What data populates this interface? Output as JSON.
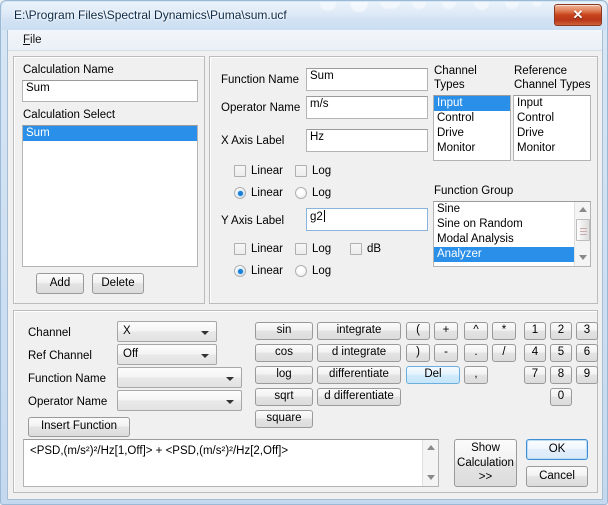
{
  "window": {
    "title": "E:\\Program Files\\Spectral Dynamics\\Puma\\sum.ucf",
    "close_label": "✕"
  },
  "menubar": {
    "file_label": "File"
  },
  "left_panel": {
    "calculation_name_label": "Calculation Name",
    "calculation_name_value": "Sum",
    "calculation_select_label": "Calculation Select",
    "calculation_select_items": [
      "Sum"
    ],
    "calculation_select_selected": "Sum",
    "add_label": "Add",
    "delete_label": "Delete"
  },
  "definition_panel": {
    "function_name_label": "Function Name",
    "function_name_value": "Sum",
    "operator_name_label": "Operator Name",
    "operator_name_value": "m/s",
    "x_axis_label": "X Axis Label",
    "x_axis_value": "Hz",
    "y_axis_label": "Y Axis Label",
    "y_axis_value": "g2",
    "x_check_linear_label": "Linear",
    "x_check_log_label": "Log",
    "x_radio_linear_label": "Linear",
    "x_radio_log_label": "Log",
    "x_radio_selected": "Linear",
    "y_check_linear_label": "Linear",
    "y_check_log_label": "Log",
    "y_check_db_label": "dB",
    "y_radio_linear_label": "Linear",
    "y_radio_log_label": "Log",
    "y_radio_selected": "Linear"
  },
  "channels_panel": {
    "channel_types_label_line1": "Channel",
    "channel_types_label_line2": "Types",
    "reference_types_label_line1": "Reference",
    "reference_types_label_line2": "Channel Types",
    "channel_types_items": [
      "Input",
      "Control",
      "Drive",
      "Monitor"
    ],
    "channel_types_selected": "Input",
    "reference_types_items": [
      "Input",
      "Control",
      "Drive",
      "Monitor"
    ],
    "reference_types_selected": "",
    "function_group_label": "Function Group",
    "function_group_items": [
      "Sine",
      "Sine on Random",
      "Modal Analysis",
      "Analyzer"
    ],
    "function_group_selected": "Analyzer"
  },
  "builder_panel": {
    "channel_label": "Channel",
    "channel_value": "X",
    "ref_channel_label": "Ref Channel",
    "ref_channel_value": "Off",
    "function_name_label": "Function Name",
    "function_name_value": "",
    "operator_name_label": "Operator Name",
    "operator_name_value": "",
    "insert_function_label": "Insert Function",
    "func_buttons_col1": [
      "sin",
      "cos",
      "log",
      "sqrt",
      "square"
    ],
    "func_buttons_col2": [
      "integrate",
      "d integrate",
      "differentiate",
      "d differentiate"
    ],
    "keypad_sym_col1": [
      "(",
      ")",
      "Del"
    ],
    "keypad_sym_col2": [
      "+",
      "-"
    ],
    "keypad_sym_col3": [
      "^",
      ".",
      ","
    ],
    "keypad_sym_col4": [
      "*",
      "/"
    ],
    "keypad_digits": [
      "1",
      "2",
      "3",
      "4",
      "5",
      "6",
      "7",
      "8",
      "9",
      "0"
    ],
    "del_label": "Del",
    "formula_text": "<PSD,(m/s²)²/Hz[1,Off]> + <PSD,(m/s²)²/Hz[2,Off]>",
    "show_calculation_line1": "Show",
    "show_calculation_line2": "Calculation",
    "show_calculation_line3": ">>",
    "ok_label": "OK",
    "cancel_label": "Cancel"
  },
  "colors": {
    "selection_blue": "#2a8fe8",
    "close_red": "#c9431c",
    "window_bg": "#f0f0f0"
  }
}
